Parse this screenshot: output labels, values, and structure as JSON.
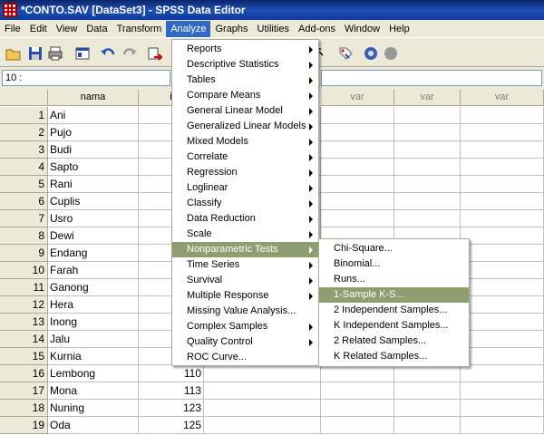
{
  "window": {
    "title": "*CONTO.SAV [DataSet3] - SPSS Data Editor"
  },
  "menubar": [
    "File",
    "Edit",
    "View",
    "Data",
    "Transform",
    "Analyze",
    "Graphs",
    "Utilities",
    "Add-ons",
    "Window",
    "Help"
  ],
  "active_menu": "Analyze",
  "cell_ref": "10 :",
  "grid": {
    "columns": [
      "nama",
      "i",
      "var",
      "var",
      "var"
    ],
    "rows": [
      {
        "n": "1",
        "nama": "Ani",
        "val": ""
      },
      {
        "n": "2",
        "nama": "Pujo",
        "val": ""
      },
      {
        "n": "3",
        "nama": "Budi",
        "val": ""
      },
      {
        "n": "4",
        "nama": "Sapto",
        "val": ""
      },
      {
        "n": "5",
        "nama": "Rani",
        "val": ""
      },
      {
        "n": "6",
        "nama": "Cuplis",
        "val": ""
      },
      {
        "n": "7",
        "nama": "Usro",
        "val": ""
      },
      {
        "n": "8",
        "nama": "Dewi",
        "val": ""
      },
      {
        "n": "9",
        "nama": "Endang",
        "val": ""
      },
      {
        "n": "10",
        "nama": "Farah",
        "val": ""
      },
      {
        "n": "11",
        "nama": "Ganong",
        "val": ""
      },
      {
        "n": "12",
        "nama": "Hera",
        "val": ""
      },
      {
        "n": "13",
        "nama": "Inong",
        "val": ""
      },
      {
        "n": "14",
        "nama": "Jalu",
        "val": ""
      },
      {
        "n": "15",
        "nama": "Kurnia",
        "val": ""
      },
      {
        "n": "16",
        "nama": "Lembong",
        "val": "110"
      },
      {
        "n": "17",
        "nama": "Mona",
        "val": "113"
      },
      {
        "n": "18",
        "nama": "Nuning",
        "val": "123"
      },
      {
        "n": "19",
        "nama": "Oda",
        "val": "125"
      }
    ]
  },
  "analyze_menu": [
    {
      "label": "Reports",
      "sub": true
    },
    {
      "label": "Descriptive Statistics",
      "sub": true
    },
    {
      "label": "Tables",
      "sub": true
    },
    {
      "label": "Compare Means",
      "sub": true
    },
    {
      "label": "General Linear Model",
      "sub": true
    },
    {
      "label": "Generalized Linear Models",
      "sub": true
    },
    {
      "label": "Mixed Models",
      "sub": true
    },
    {
      "label": "Correlate",
      "sub": true
    },
    {
      "label": "Regression",
      "sub": true
    },
    {
      "label": "Loglinear",
      "sub": true
    },
    {
      "label": "Classify",
      "sub": true
    },
    {
      "label": "Data Reduction",
      "sub": true
    },
    {
      "label": "Scale",
      "sub": true
    },
    {
      "label": "Nonparametric Tests",
      "sub": true,
      "highlighted": true
    },
    {
      "label": "Time Series",
      "sub": true
    },
    {
      "label": "Survival",
      "sub": true
    },
    {
      "label": "Multiple Response",
      "sub": true
    },
    {
      "label": "Missing Value Analysis...",
      "sub": false
    },
    {
      "label": "Complex Samples",
      "sub": true
    },
    {
      "label": "Quality Control",
      "sub": true
    },
    {
      "label": "ROC Curve...",
      "sub": false
    }
  ],
  "nonparametric_menu": [
    {
      "label": "Chi-Square..."
    },
    {
      "label": "Binomial..."
    },
    {
      "label": "Runs..."
    },
    {
      "label": "1-Sample K-S...",
      "highlighted": true
    },
    {
      "label": "2 Independent Samples..."
    },
    {
      "label": "K Independent Samples..."
    },
    {
      "label": "2 Related Samples..."
    },
    {
      "label": "K Related Samples..."
    }
  ],
  "colors": {
    "menu_highlight": "#8e9e70",
    "titlebar": "#0a246a",
    "active_menu": "#316ac5"
  },
  "toolbar_icons": [
    "open-folder-icon",
    "save-icon",
    "print-icon",
    "dialog-recall-icon",
    "undo-icon",
    "redo-icon",
    "goto-case-icon",
    "weight-cases-icon",
    "value-labels-icon",
    "use-sets-icon",
    "show-all-icon"
  ]
}
